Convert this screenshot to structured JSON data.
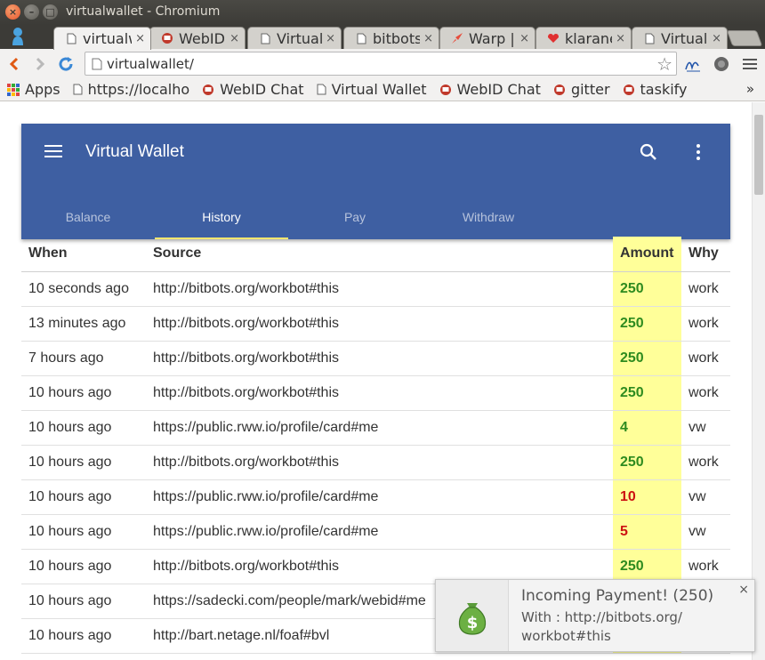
{
  "window": {
    "title": "virtualwallet - Chromium"
  },
  "tabs": [
    {
      "label": "virtualwallet",
      "favicon": "page-icon",
      "active": true
    },
    {
      "label": "WebID",
      "favicon": "webid-icon",
      "active": false
    },
    {
      "label": "Virtual",
      "favicon": "page-icon",
      "active": false
    },
    {
      "label": "bitbots",
      "favicon": "page-icon",
      "active": false
    },
    {
      "label": "Warp |",
      "favicon": "rocket-icon",
      "active": false
    },
    {
      "label": "klarane",
      "favicon": "heart-icon",
      "active": false
    },
    {
      "label": "Virtual",
      "favicon": "page-icon",
      "active": false
    }
  ],
  "address_bar": {
    "value": "virtualwallet/"
  },
  "bookmarks": [
    {
      "label": "Apps",
      "icon": "apps-grid-icon"
    },
    {
      "label": "https://localho",
      "icon": "page-icon"
    },
    {
      "label": "WebID Chat",
      "icon": "webid-icon"
    },
    {
      "label": "Virtual Wallet",
      "icon": "page-icon"
    },
    {
      "label": "WebID Chat",
      "icon": "webid-icon"
    },
    {
      "label": "gitter",
      "icon": "webid-icon"
    },
    {
      "label": "taskify",
      "icon": "webid-icon"
    }
  ],
  "bookmarks_overflow": "»",
  "app": {
    "title": "Virtual Wallet",
    "accent_color": "#3e5fa2",
    "tab_indicator_color": "#f7e66e",
    "nav_tabs": [
      "Balance",
      "History",
      "Pay",
      "Withdraw"
    ],
    "active_tab": "History"
  },
  "history": {
    "headers": {
      "when": "When",
      "source": "Source",
      "amount": "Amount",
      "why": "Why"
    },
    "rows": [
      {
        "when": "10 seconds ago",
        "source": "http://bitbots.org/workbot#this",
        "amount": "250",
        "direction": "in",
        "why": "work"
      },
      {
        "when": "13 minutes ago",
        "source": "http://bitbots.org/workbot#this",
        "amount": "250",
        "direction": "in",
        "why": "work"
      },
      {
        "when": "7 hours ago",
        "source": "http://bitbots.org/workbot#this",
        "amount": "250",
        "direction": "in",
        "why": "work"
      },
      {
        "when": "10 hours ago",
        "source": "http://bitbots.org/workbot#this",
        "amount": "250",
        "direction": "in",
        "why": "work"
      },
      {
        "when": "10 hours ago",
        "source": "https://public.rww.io/profile/card#me",
        "amount": "4",
        "direction": "in",
        "why": "vw"
      },
      {
        "when": "10 hours ago",
        "source": "http://bitbots.org/workbot#this",
        "amount": "250",
        "direction": "in",
        "why": "work"
      },
      {
        "when": "10 hours ago",
        "source": "https://public.rww.io/profile/card#me",
        "amount": "10",
        "direction": "out",
        "why": "vw"
      },
      {
        "when": "10 hours ago",
        "source": "https://public.rww.io/profile/card#me",
        "amount": "5",
        "direction": "out",
        "why": "vw"
      },
      {
        "when": "10 hours ago",
        "source": "http://bitbots.org/workbot#this",
        "amount": "250",
        "direction": "in",
        "why": "work"
      },
      {
        "when": "10 hours ago",
        "source": "https://sadecki.com/people/mark/webid#me",
        "amount": "",
        "direction": "in",
        "why": ""
      },
      {
        "when": "10 hours ago",
        "source": "http://bart.netage.nl/foaf#bvl",
        "amount": "",
        "direction": "in",
        "why": ""
      }
    ]
  },
  "notification": {
    "title": "Incoming Payment! (250)",
    "body_line1": "With : http://bitbots.org/",
    "body_line2": "workbot#this",
    "icon": "money-bag-icon",
    "close_label": "×"
  },
  "colors": {
    "amount_in": "#2e8b1f",
    "amount_out": "#cc1111",
    "amount_column_bg": "#ffff99"
  }
}
